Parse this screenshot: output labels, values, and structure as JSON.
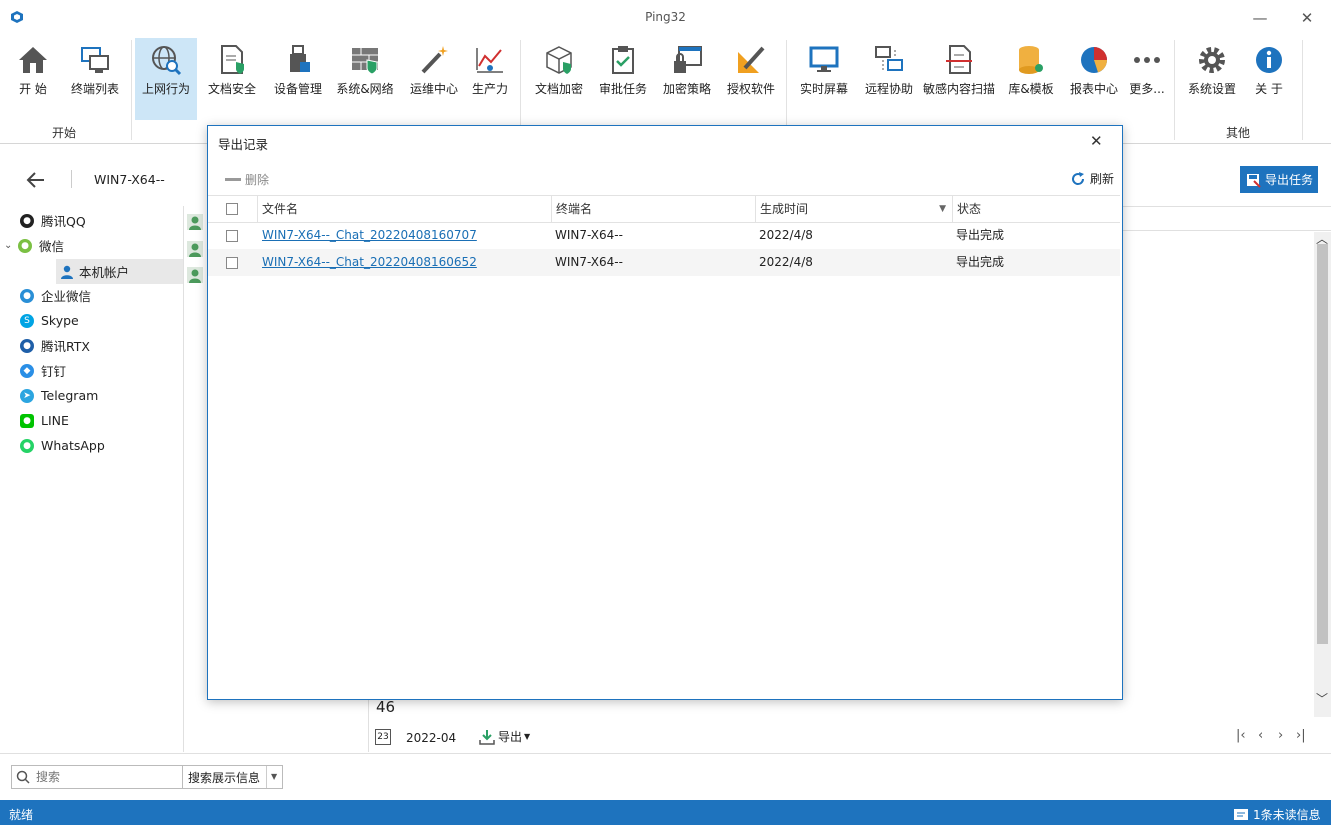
{
  "window": {
    "title": "Ping32"
  },
  "ribbon": {
    "buttons": [
      {
        "label": "开  始"
      },
      {
        "label": "终端列表"
      },
      {
        "label": "上网行为"
      },
      {
        "label": "文档安全"
      },
      {
        "label": "设备管理"
      },
      {
        "label": "系统&网络"
      },
      {
        "label": "运维中心"
      },
      {
        "label": "生产力"
      },
      {
        "label": "文档加密"
      },
      {
        "label": "审批任务"
      },
      {
        "label": "加密策略"
      },
      {
        "label": "授权软件"
      },
      {
        "label": "实时屏幕"
      },
      {
        "label": "远程协助"
      },
      {
        "label": "敏感内容扫描"
      },
      {
        "label": "库&模板"
      },
      {
        "label": "报表中心"
      },
      {
        "label": "更多..."
      },
      {
        "label": "系统设置"
      },
      {
        "label": "关  于"
      }
    ],
    "groups": {
      "start": "开始",
      "other": "其他"
    }
  },
  "subheader": {
    "computer": "WIN7-X64--",
    "export_task": "导出任务"
  },
  "tree": {
    "items": [
      {
        "label": "腾讯QQ"
      },
      {
        "label": "微信"
      },
      {
        "label": "本机帐户"
      },
      {
        "label": "企业微信"
      },
      {
        "label": "Skype"
      },
      {
        "label": "腾讯RTX"
      },
      {
        "label": "钉钉"
      },
      {
        "label": "Telegram"
      },
      {
        "label": "LINE"
      },
      {
        "label": "WhatsApp"
      }
    ]
  },
  "content": {
    "count": "46",
    "date": "2022-04",
    "calendar_day": "23",
    "export_label": "导出"
  },
  "search": {
    "placeholder": "搜索",
    "mode": "搜索展示信息"
  },
  "status": {
    "left": "就绪",
    "right": "1条未读信息"
  },
  "dialog": {
    "title": "导出记录",
    "delete": "删除",
    "refresh": "刷新",
    "columns": [
      "文件名",
      "终端名",
      "生成时间",
      "状态"
    ],
    "rows": [
      {
        "file": "WIN7-X64--_Chat_20220408160707",
        "terminal": "WIN7-X64--",
        "time": "2022/4/8",
        "status": "导出完成"
      },
      {
        "file": "WIN7-X64--_Chat_20220408160652",
        "terminal": "WIN7-X64--",
        "time": "2022/4/8",
        "status": "导出完成"
      }
    ]
  },
  "colors": {
    "accent": "#1e73be",
    "active": "#cde6f7"
  }
}
